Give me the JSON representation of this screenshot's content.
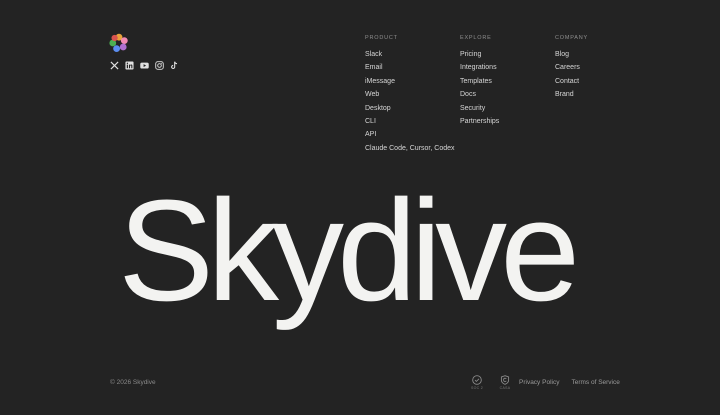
{
  "brand": {
    "logo_icon": "pinwheel-logo-icon",
    "logo_colors": [
      "#e9a23b",
      "#d9534f",
      "#5b8def",
      "#4caf50",
      "#b06fd0",
      "#f28ab2"
    ],
    "wordmark": "Skydive"
  },
  "social": [
    {
      "icon": "x-icon"
    },
    {
      "icon": "linkedin-icon"
    },
    {
      "icon": "youtube-icon"
    },
    {
      "icon": "instagram-icon"
    },
    {
      "icon": "tiktok-icon"
    }
  ],
  "columns": {
    "product": {
      "title": "PRODUCT",
      "items": [
        "Slack",
        "Email",
        "iMessage",
        "Web",
        "Desktop",
        "CLI",
        "API",
        "Claude Code, Cursor, Codex"
      ]
    },
    "explore": {
      "title": "EXPLORE",
      "items": [
        "Pricing",
        "Integrations",
        "Templates",
        "Docs",
        "Security",
        "Partnerships"
      ]
    },
    "company": {
      "title": "COMPANY",
      "items": [
        "Blog",
        "Careers",
        "Contact",
        "Brand"
      ]
    }
  },
  "footer": {
    "copyright": "© 2026 Skydive",
    "badges": [
      {
        "icon": "check-shield-icon",
        "label": "SOC 2"
      },
      {
        "icon": "shield-icon",
        "label": "CASA"
      }
    ],
    "privacy": "Privacy Policy",
    "terms": "Terms of Service"
  },
  "colors": {
    "background": "#232323",
    "text": "#d6d6d6",
    "muted": "#8e8e8e",
    "wordmark": "#f3f3f1"
  }
}
